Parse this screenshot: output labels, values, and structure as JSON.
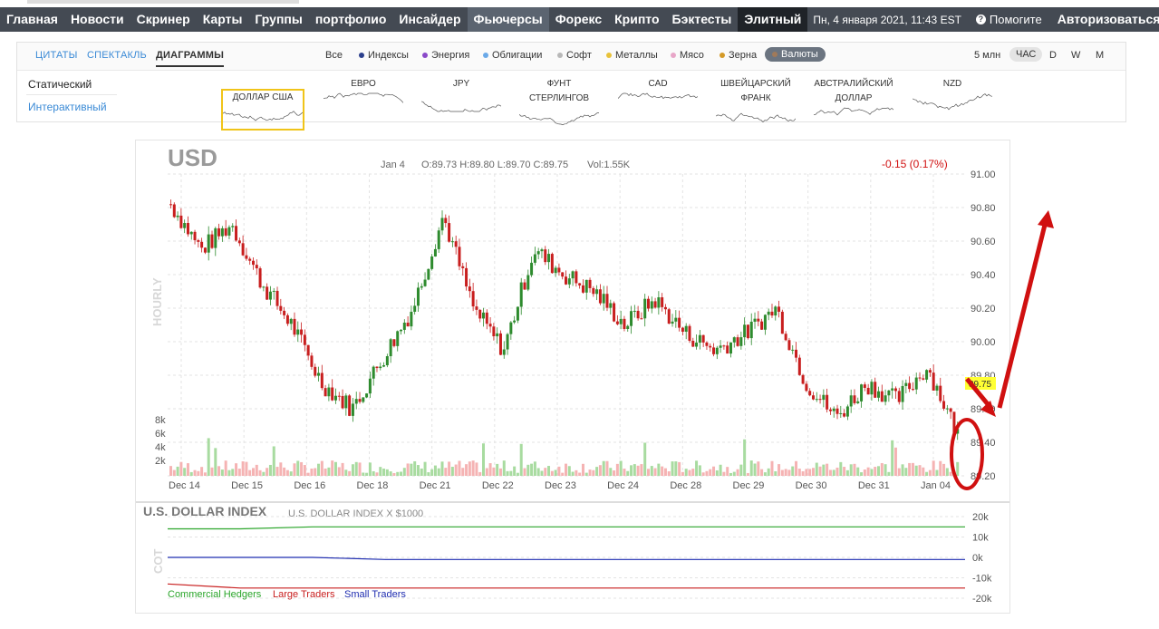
{
  "nav": {
    "items": [
      "Главная",
      "Новости",
      "Скринер",
      "Карты",
      "Группы",
      "портфолио",
      "Инсайдер",
      "Фьючерсы",
      "Форекс",
      "Крипто",
      "Бэктесты",
      "Элитный"
    ],
    "active": "Фьючерсы",
    "datetime": "Пн, 4 января 2021, 11:43 EST",
    "help": "Помогите",
    "login": "Авторизоваться"
  },
  "subtabs": [
    "ЦИТАТЫ",
    "СПЕКТАКЛЬ",
    "ДИАГРАММЫ"
  ],
  "subtab_active": "ДИАГРАММЫ",
  "filters": [
    {
      "label": "Все",
      "color": ""
    },
    {
      "label": "Индексы",
      "color": "#2b3f8c"
    },
    {
      "label": "Энергия",
      "color": "#8a49c9"
    },
    {
      "label": "Облигации",
      "color": "#6aa9e8"
    },
    {
      "label": "Софт",
      "color": "#b8b8b8"
    },
    {
      "label": "Металлы",
      "color": "#e8c23a"
    },
    {
      "label": "Мясо",
      "color": "#e8a6c8"
    },
    {
      "label": "Зерна",
      "color": "#d49a28"
    },
    {
      "label": "Валюты",
      "color": "#a07a5a"
    }
  ],
  "filter_active": "Валюты",
  "timeframes": [
    "5 млн",
    "ЧАС",
    "D",
    "W",
    "M"
  ],
  "timeframe_active": "ЧАС",
  "side_links": [
    "Статический",
    "Интерактивный"
  ],
  "side_active": "Статический",
  "minis": [
    {
      "line1": "",
      "line2": "ДОЛЛАР США"
    },
    {
      "line1": "",
      "line2": "ЕВРО"
    },
    {
      "line1": "",
      "line2": "JPY"
    },
    {
      "line1": "ФУНТ",
      "line2": "СТЕРЛИНГОВ"
    },
    {
      "line1": "",
      "line2": "CAD"
    },
    {
      "line1": "ШВЕЙЦАРСКИЙ",
      "line2": "ФРАНК"
    },
    {
      "line1": "АВСТРАЛИЙСКИЙ",
      "line2": "ДОЛЛАР"
    },
    {
      "line1": "",
      "line2": "NZD"
    }
  ],
  "chart": {
    "symbol": "USD",
    "date": "Jan 4",
    "ohlc": "O:89.73  H:89.80  L:89.70  C:89.75",
    "vol": "Vol:1.55K",
    "change": "-0.15 (0.17%)",
    "last_price_label": "89.75",
    "period_label": "HOURLY",
    "cot_label": "COT",
    "cot_title": "U.S. DOLLAR INDEX",
    "cot_subtitle": "U.S. DOLLAR INDEX X $1000",
    "legend": [
      {
        "label": "Commercial Hedgers",
        "color": "#2aa52a"
      },
      {
        "label": "Large Traders",
        "color": "#c81e1e"
      },
      {
        "label": "Small Traders",
        "color": "#1f2db0"
      }
    ],
    "colors": {
      "up": "#2e8b2e",
      "down": "#c81e1e",
      "vol_up": "#a8dba0",
      "vol_down": "#f5b3b3",
      "annotation": "#d01010",
      "highlight": "#ffff33"
    }
  },
  "chart_data": [
    {
      "type": "candlestick",
      "title": "USD",
      "x_categories": [
        "Dec 14",
        "Dec 15",
        "Dec 16",
        "Dec 18",
        "Dec 21",
        "Dec 22",
        "Dec 23",
        "Dec 24",
        "Dec 28",
        "Dec 29",
        "Dec 30",
        "Dec 31",
        "Jan 04"
      ],
      "y_ticks": [
        "91.00",
        "90.80",
        "90.60",
        "90.40",
        "90.20",
        "90.00",
        "89.80",
        "89.60",
        "89.40",
        "89.20"
      ],
      "ylim": [
        89.2,
        91.0
      ],
      "approx_closes": [
        90.82,
        90.55,
        90.7,
        90.35,
        90.1,
        89.75,
        89.6,
        89.9,
        90.2,
        90.75,
        90.2,
        89.95,
        90.55,
        90.4,
        90.3,
        90.1,
        90.25,
        90.05,
        89.95,
        90.05,
        90.2,
        89.75,
        89.55,
        89.75,
        89.65,
        89.85,
        89.45
      ],
      "volume_ticks": [
        "8k",
        "6k",
        "4k",
        "2k"
      ]
    },
    {
      "type": "line",
      "title": "U.S. DOLLAR INDEX",
      "y_ticks": [
        "20k",
        "10k",
        "0k",
        "-10k",
        "-20k"
      ],
      "ylim": [
        -20,
        20
      ],
      "series": [
        {
          "name": "Commercial Hedgers",
          "values": [
            14,
            14,
            15,
            15,
            15,
            15,
            15,
            15,
            15,
            15,
            15,
            15
          ]
        },
        {
          "name": "Large Traders",
          "values": [
            -13,
            -15,
            -15,
            -15,
            -15,
            -15,
            -15,
            -15,
            -15,
            -15,
            -15,
            -15
          ]
        },
        {
          "name": "Small Traders",
          "values": [
            0,
            0,
            0,
            -1,
            -1,
            -1,
            -1,
            -1,
            -1,
            -1,
            -1,
            -1
          ]
        }
      ]
    }
  ]
}
